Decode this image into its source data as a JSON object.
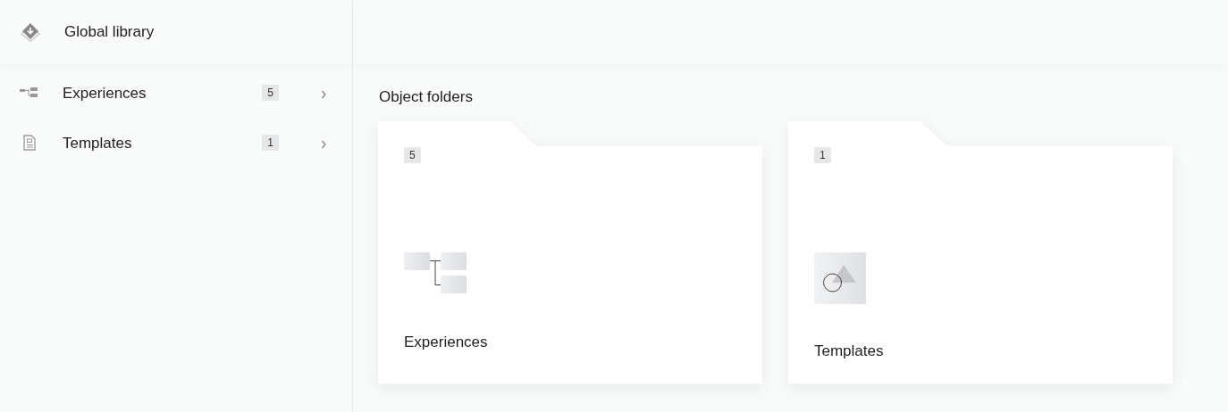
{
  "sidebar": {
    "title": "Global library",
    "items": [
      {
        "kind": "experiences",
        "label": "Experiences",
        "count": "5",
        "chevron": "›"
      },
      {
        "kind": "templates",
        "label": "Templates",
        "count": "1",
        "chevron": "›"
      }
    ]
  },
  "main": {
    "heading": "Object folders",
    "folders": [
      {
        "kind": "experiences",
        "count": "5",
        "label": "Experiences"
      },
      {
        "kind": "templates",
        "count": "1",
        "label": "Templates"
      }
    ]
  }
}
